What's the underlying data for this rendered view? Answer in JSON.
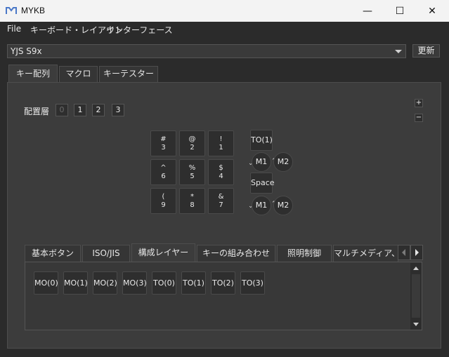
{
  "window": {
    "title": "MYKB",
    "minimize": "—",
    "maximize": "☐",
    "close": "✕"
  },
  "menu": {
    "file": "File",
    "keyboard_layout": "キーボード・レイアウト",
    "interface": "インターフェース"
  },
  "device": {
    "selected": "YJS S9x",
    "refresh_label": "更新"
  },
  "tabs": [
    "キー配列",
    "マクロ",
    "キーテスター"
  ],
  "layers": {
    "label": "配置層",
    "buttons": [
      "0",
      "1",
      "2",
      "3"
    ]
  },
  "zoom": {
    "plus": "+",
    "minus": "−"
  },
  "keys": [
    {
      "top": "#",
      "bottom": "3"
    },
    {
      "top": "@",
      "bottom": "2"
    },
    {
      "top": "!",
      "bottom": "1"
    },
    {
      "top": "^",
      "bottom": "6"
    },
    {
      "top": "%",
      "bottom": "5"
    },
    {
      "top": "$",
      "bottom": "4"
    },
    {
      "top": "(",
      "bottom": "9"
    },
    {
      "top": "*",
      "bottom": "8"
    },
    {
      "top": "&",
      "bottom": "7"
    }
  ],
  "side_keys": {
    "to1": "TO(1)",
    "space": "Space",
    "m1": "M1",
    "m2": "M2",
    "m1b": "M1",
    "m2b": "M2"
  },
  "subtabs": [
    "基本ボタン",
    "ISO/JIS",
    "構成レイヤー",
    "キーの組み合わせ",
    "照明制御",
    "マルチメディア、マ"
  ],
  "layer_keys": [
    "MO(0)",
    "MO(1)",
    "MO(2)",
    "MO(3)",
    "TO(0)",
    "TO(1)",
    "TO(2)",
    "TO(3)"
  ]
}
